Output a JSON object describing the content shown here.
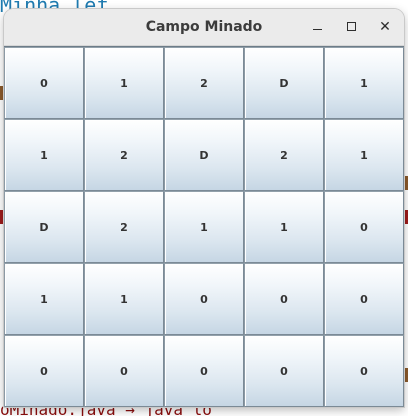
{
  "window": {
    "title": "Campo Minado",
    "controls": {
      "minimize": "minimize-icon",
      "maximize": "maximize-icon",
      "close": "close-icon"
    }
  },
  "background": {
    "top_text": "Minha_lef",
    "bottom_text": "oMinado.java → java lo"
  },
  "board": {
    "rows": [
      [
        "0",
        "1",
        "2",
        "D",
        "1"
      ],
      [
        "1",
        "2",
        "D",
        "2",
        "1"
      ],
      [
        "D",
        "2",
        "1",
        "1",
        "0"
      ],
      [
        "1",
        "1",
        "0",
        "0",
        "0"
      ],
      [
        "0",
        "0",
        "0",
        "0",
        "0"
      ]
    ]
  },
  "colors": {
    "titlebar": "#ebebeb",
    "cell_gradient_top": "#ffffff",
    "cell_gradient_bottom": "#c6d6e4",
    "grid_lines": "#6d7c88",
    "cell_text": "#333333"
  }
}
